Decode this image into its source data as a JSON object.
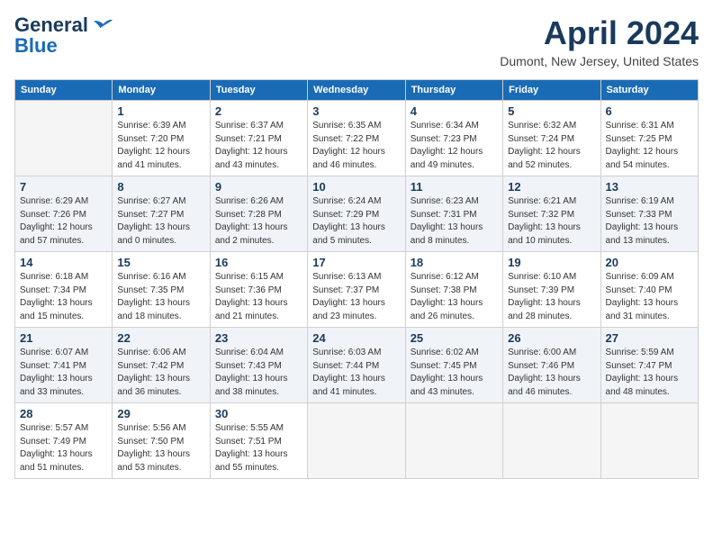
{
  "header": {
    "logo_line1": "General",
    "logo_line2": "Blue",
    "month": "April 2024",
    "location": "Dumont, New Jersey, United States"
  },
  "weekdays": [
    "Sunday",
    "Monday",
    "Tuesday",
    "Wednesday",
    "Thursday",
    "Friday",
    "Saturday"
  ],
  "weeks": [
    [
      {
        "day": "",
        "empty": true
      },
      {
        "day": "1",
        "sunrise": "6:39 AM",
        "sunset": "7:20 PM",
        "daylight": "12 hours and 41 minutes."
      },
      {
        "day": "2",
        "sunrise": "6:37 AM",
        "sunset": "7:21 PM",
        "daylight": "12 hours and 43 minutes."
      },
      {
        "day": "3",
        "sunrise": "6:35 AM",
        "sunset": "7:22 PM",
        "daylight": "12 hours and 46 minutes."
      },
      {
        "day": "4",
        "sunrise": "6:34 AM",
        "sunset": "7:23 PM",
        "daylight": "12 hours and 49 minutes."
      },
      {
        "day": "5",
        "sunrise": "6:32 AM",
        "sunset": "7:24 PM",
        "daylight": "12 hours and 52 minutes."
      },
      {
        "day": "6",
        "sunrise": "6:31 AM",
        "sunset": "7:25 PM",
        "daylight": "12 hours and 54 minutes."
      }
    ],
    [
      {
        "day": "7",
        "sunrise": "6:29 AM",
        "sunset": "7:26 PM",
        "daylight": "12 hours and 57 minutes."
      },
      {
        "day": "8",
        "sunrise": "6:27 AM",
        "sunset": "7:27 PM",
        "daylight": "13 hours and 0 minutes."
      },
      {
        "day": "9",
        "sunrise": "6:26 AM",
        "sunset": "7:28 PM",
        "daylight": "13 hours and 2 minutes."
      },
      {
        "day": "10",
        "sunrise": "6:24 AM",
        "sunset": "7:29 PM",
        "daylight": "13 hours and 5 minutes."
      },
      {
        "day": "11",
        "sunrise": "6:23 AM",
        "sunset": "7:31 PM",
        "daylight": "13 hours and 8 minutes."
      },
      {
        "day": "12",
        "sunrise": "6:21 AM",
        "sunset": "7:32 PM",
        "daylight": "13 hours and 10 minutes."
      },
      {
        "day": "13",
        "sunrise": "6:19 AM",
        "sunset": "7:33 PM",
        "daylight": "13 hours and 13 minutes."
      }
    ],
    [
      {
        "day": "14",
        "sunrise": "6:18 AM",
        "sunset": "7:34 PM",
        "daylight": "13 hours and 15 minutes."
      },
      {
        "day": "15",
        "sunrise": "6:16 AM",
        "sunset": "7:35 PM",
        "daylight": "13 hours and 18 minutes."
      },
      {
        "day": "16",
        "sunrise": "6:15 AM",
        "sunset": "7:36 PM",
        "daylight": "13 hours and 21 minutes."
      },
      {
        "day": "17",
        "sunrise": "6:13 AM",
        "sunset": "7:37 PM",
        "daylight": "13 hours and 23 minutes."
      },
      {
        "day": "18",
        "sunrise": "6:12 AM",
        "sunset": "7:38 PM",
        "daylight": "13 hours and 26 minutes."
      },
      {
        "day": "19",
        "sunrise": "6:10 AM",
        "sunset": "7:39 PM",
        "daylight": "13 hours and 28 minutes."
      },
      {
        "day": "20",
        "sunrise": "6:09 AM",
        "sunset": "7:40 PM",
        "daylight": "13 hours and 31 minutes."
      }
    ],
    [
      {
        "day": "21",
        "sunrise": "6:07 AM",
        "sunset": "7:41 PM",
        "daylight": "13 hours and 33 minutes."
      },
      {
        "day": "22",
        "sunrise": "6:06 AM",
        "sunset": "7:42 PM",
        "daylight": "13 hours and 36 minutes."
      },
      {
        "day": "23",
        "sunrise": "6:04 AM",
        "sunset": "7:43 PM",
        "daylight": "13 hours and 38 minutes."
      },
      {
        "day": "24",
        "sunrise": "6:03 AM",
        "sunset": "7:44 PM",
        "daylight": "13 hours and 41 minutes."
      },
      {
        "day": "25",
        "sunrise": "6:02 AM",
        "sunset": "7:45 PM",
        "daylight": "13 hours and 43 minutes."
      },
      {
        "day": "26",
        "sunrise": "6:00 AM",
        "sunset": "7:46 PM",
        "daylight": "13 hours and 46 minutes."
      },
      {
        "day": "27",
        "sunrise": "5:59 AM",
        "sunset": "7:47 PM",
        "daylight": "13 hours and 48 minutes."
      }
    ],
    [
      {
        "day": "28",
        "sunrise": "5:57 AM",
        "sunset": "7:49 PM",
        "daylight": "13 hours and 51 minutes."
      },
      {
        "day": "29",
        "sunrise": "5:56 AM",
        "sunset": "7:50 PM",
        "daylight": "13 hours and 53 minutes."
      },
      {
        "day": "30",
        "sunrise": "5:55 AM",
        "sunset": "7:51 PM",
        "daylight": "13 hours and 55 minutes."
      },
      {
        "day": "",
        "empty": true
      },
      {
        "day": "",
        "empty": true
      },
      {
        "day": "",
        "empty": true
      },
      {
        "day": "",
        "empty": true
      }
    ]
  ]
}
